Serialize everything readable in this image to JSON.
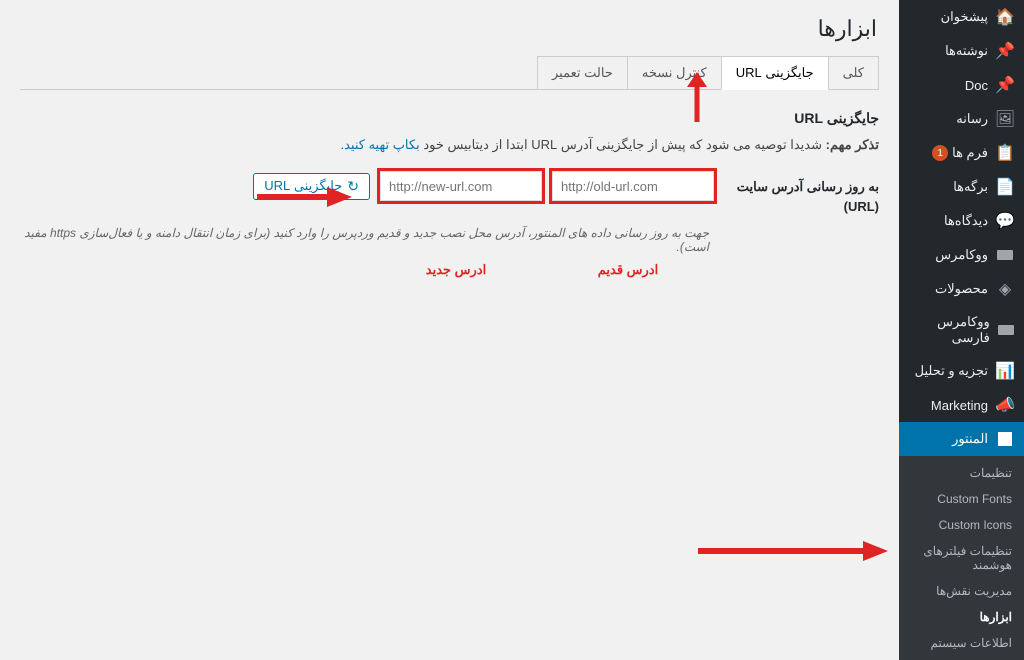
{
  "page_title": "ابزارها",
  "sidebar": {
    "items": [
      {
        "label": "پیشخوان",
        "icon": "dashboard"
      },
      {
        "label": "نوشته‌ها",
        "icon": "pin"
      },
      {
        "label": "Doc",
        "icon": "pin"
      },
      {
        "label": "رسانه",
        "icon": "media"
      },
      {
        "label": "فرم ها",
        "icon": "form",
        "badge": "1"
      },
      {
        "label": "برگه‌ها",
        "icon": "page"
      },
      {
        "label": "دیدگاه‌ها",
        "icon": "comment"
      },
      {
        "label": "ووکامرس",
        "icon": "woo"
      },
      {
        "label": "محصولات",
        "icon": "product"
      },
      {
        "label": "ووکامرس فارسی",
        "icon": "woo"
      },
      {
        "label": "تجزیه و تحلیل",
        "icon": "chart"
      },
      {
        "label": "Marketing",
        "icon": "megaphone"
      }
    ],
    "active": {
      "label": "المنتور",
      "icon": "elementor"
    },
    "submenu": [
      {
        "label": "تنظیمات"
      },
      {
        "label": "Custom Fonts"
      },
      {
        "label": "Custom Icons"
      },
      {
        "label": "تنظیمات فیلترهای هوشمند"
      },
      {
        "label": "مدیریت نقش‌ها"
      },
      {
        "label": "ابزارها",
        "current": true
      },
      {
        "label": "اطلاعات سیستم"
      }
    ]
  },
  "tabs": [
    {
      "label": "کلی"
    },
    {
      "label": "جایگزینی URL",
      "active": true
    },
    {
      "label": "کنترل نسخه"
    },
    {
      "label": "حالت تعمیر"
    }
  ],
  "section": {
    "heading": "جایگزینی URL",
    "warning_prefix": "تذکر مهم:",
    "warning_text": "شدیدا توصیه می شود که پیش از جایگزینی آدرس URL ابتدا از دیتابیس خود",
    "warning_link": "بکاپ تهیه کنید",
    "form_label": "به روز رسانی آدرس سایت (URL)",
    "old_placeholder": "http://old-url.com",
    "new_placeholder": "http://new-url.com",
    "button_label": "جایگزینی URL",
    "old_caption": "ادرس قدیم",
    "new_caption": "ادرس جدید",
    "helper": "جهت به روز رسانی داده های المنتور، آدرس محل نصب جدید و قدیم وردپرس را وارد کنید (برای زمان انتقال دامنه و یا فعال‌سازی https مفید است)."
  }
}
